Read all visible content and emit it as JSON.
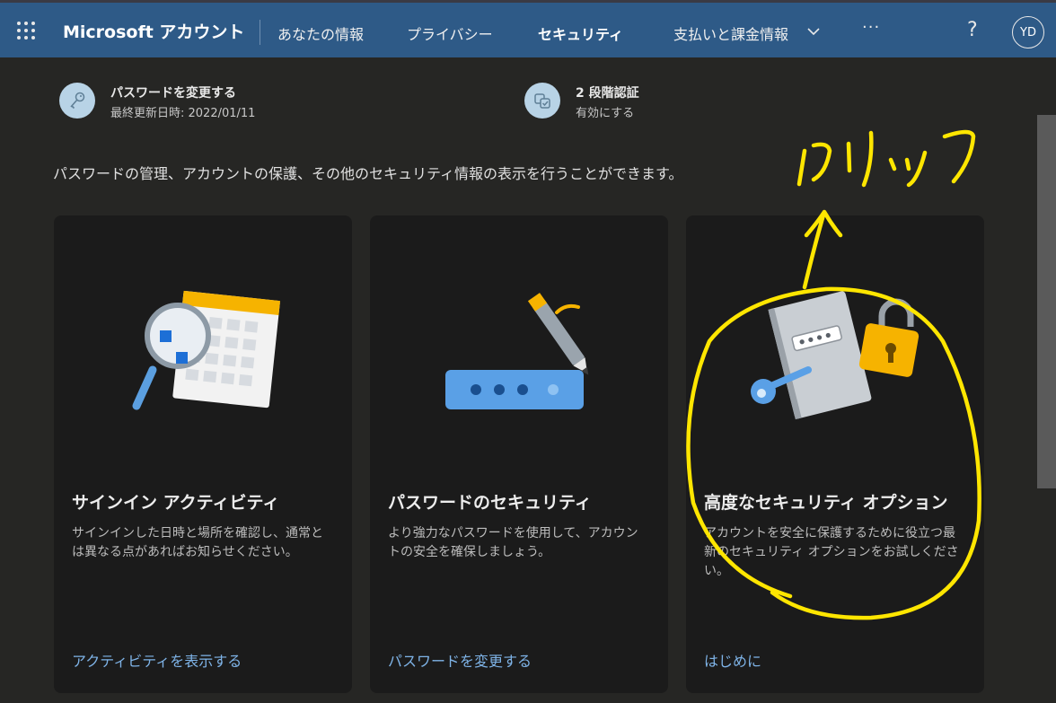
{
  "header": {
    "brand": "Microsoft アカウント",
    "nav": [
      "あなたの情報",
      "プライバシー",
      "セキュリティ",
      "支払いと課金情報"
    ],
    "more": "···",
    "help": "?",
    "avatar_initials": "YD",
    "icons": [
      "app-launcher-icon",
      "chevron-down-icon"
    ]
  },
  "quick_links": [
    {
      "title": "パスワードを変更する",
      "subtitle": "最終更新日時: 2022/01/11",
      "icon": "key-icon"
    },
    {
      "title": "2 段階認証",
      "subtitle": "有効にする",
      "icon": "two-step-icon"
    }
  ],
  "intro": "パスワードの管理、アカウントの保護、その他のセキュリティ情報の表示を行うことができます。",
  "cards": [
    {
      "title": "サインイン アクティビティ",
      "description": "サインインした日時と場所を確認し、通常とは異なる点があればお知らせください。",
      "link": "アクティビティを表示する",
      "illustration": "calendar-magnifier-illustration"
    },
    {
      "title": "パスワードのセキュリティ",
      "description": "より強力なパスワードを使用して、アカウントの安全を確保しましょう。",
      "link": "パスワードを変更する",
      "illustration": "password-pen-illustration"
    },
    {
      "title": "高度なセキュリティ オプション",
      "description": "アカウントを安全に保護するために役立つ最新のセキュリティ オプションをお試しください。",
      "link": "はじめに",
      "illustration": "key-lock-illustration"
    }
  ],
  "annotation": {
    "text": "クリック",
    "color": "#ffe600"
  },
  "colors": {
    "topbar": "#2e5a87",
    "background": "#262624",
    "card": "#1b1b1b",
    "link": "#7fb4e8",
    "accent_yellow": "#ffcf00"
  }
}
